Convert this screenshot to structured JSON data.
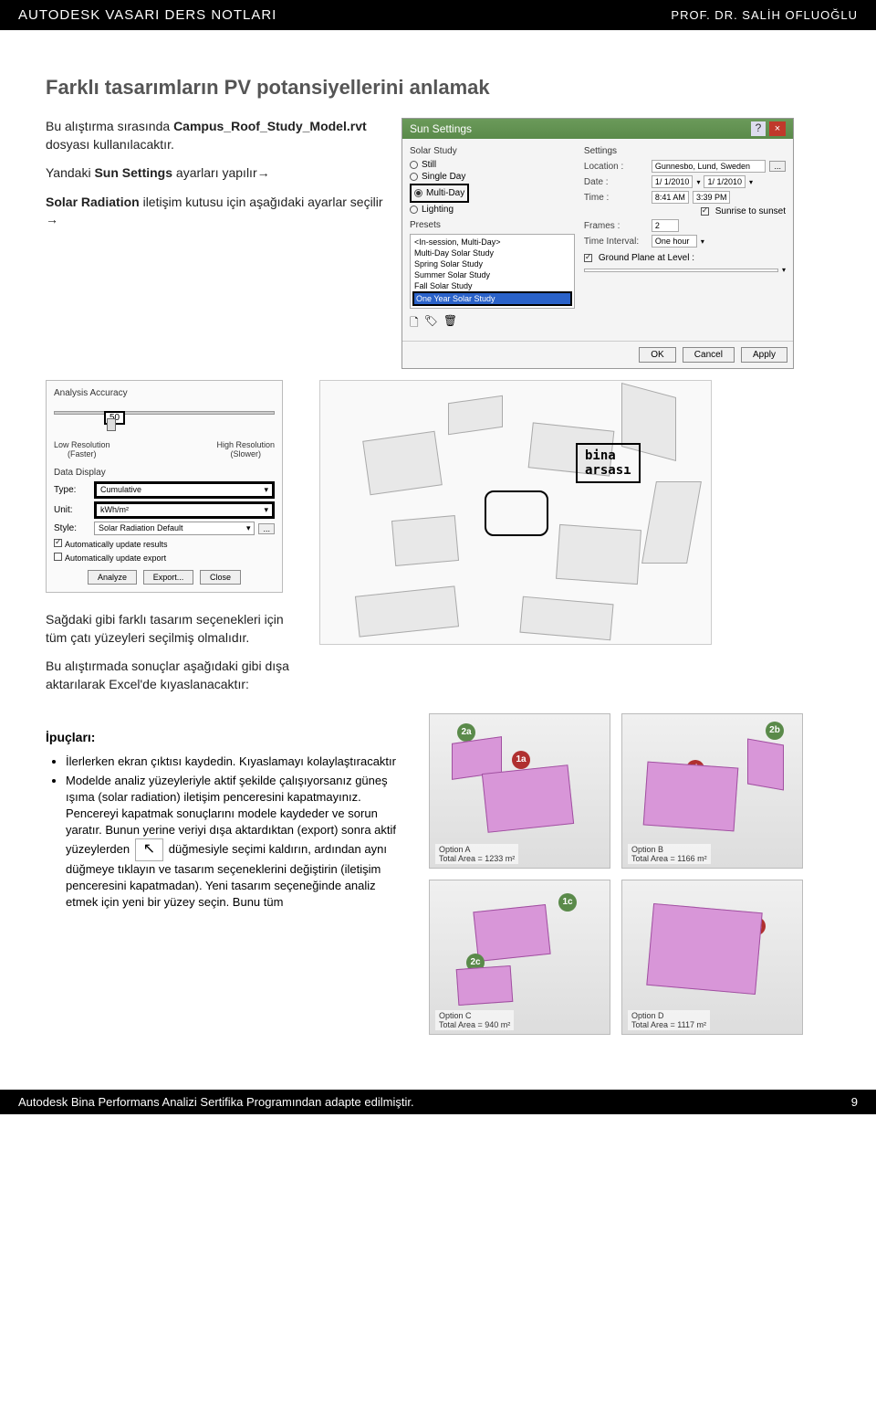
{
  "header": {
    "left": "AUTODESK VASARI DERS NOTLARI",
    "right": "PROF. DR. SALİH OFLUOĞLU"
  },
  "title": "Farklı tasarımların PV potansiyellerini anlamak",
  "intro": {
    "p1a": "Bu alıştırma sırasında ",
    "p1b": "Campus_Roof_Study_Model.rvt",
    "p1c": " dosyası kullanılacaktır.",
    "p2a": "Yandaki ",
    "p2b": "Sun Settings",
    "p2c": " ayarları yapılır→",
    "p3a": "Solar Radiation",
    "p3b": " iletişim kutusu için aşağıdaki ayarlar seçilir →"
  },
  "sun_dialog": {
    "title": "Sun Settings",
    "help": "?",
    "close": "×",
    "solar_study": "Solar Study",
    "settings": "Settings",
    "still": "Still",
    "single_day": "Single Day",
    "multi_day": "Multi-Day",
    "lighting": "Lighting",
    "location": "Location :",
    "location_val": "Gunnesbo, Lund, Sweden",
    "date": "Date :",
    "date_val1": "1/ 1/2010",
    "date_val2": "1/ 1/2010",
    "time": "Time :",
    "time_val1": "8:41 AM",
    "time_val2": "3:39 PM",
    "sunrise": "Sunrise to sunset",
    "frames": "Frames :",
    "frames_val": "2",
    "interval": "Time Interval:",
    "interval_val": "One hour",
    "ground": "Ground Plane at Level :",
    "presets": "Presets",
    "preset_items": [
      "<In-session, Multi-Day>",
      "Multi-Day Solar Study",
      "Spring Solar Study",
      "Summer Solar Study",
      "Fall Solar Study",
      "One Year Solar Study"
    ],
    "ok": "OK",
    "cancel": "Cancel",
    "apply": "Apply"
  },
  "analysis": {
    "title": "Analysis Accuracy",
    "val": "50",
    "low": "Low  Resolution\n(Faster)",
    "high": "High Resolution\n(Slower)",
    "data_display": "Data Display",
    "type": "Type:",
    "type_val": "Cumulative",
    "unit": "Unit:",
    "unit_val": "kWh/m²",
    "style": "Style:",
    "style_val": "Solar Radiation Default",
    "auto1": "Automatically update results",
    "auto2": "Automatically update export",
    "analyze": "Analyze",
    "export": "Export...",
    "close": "Close"
  },
  "map_label": "bina\narsası",
  "mid_text": {
    "p1": "Sağdaki gibi farklı tasarım seçenekleri için tüm çatı yüzeyleri seçilmiş olmalıdır.",
    "p2": "Bu alıştırmada sonuçlar aşağıdaki gibi dışa aktarılarak Excel'de kıyaslanacaktır:"
  },
  "tips_title": "İpuçları:",
  "tips": [
    "İlerlerken ekran çıktısı kaydedin. Kıyaslamayı kolaylaştıracaktır",
    "Modelde analiz yüzeyleriyle aktif şekilde çalışıyorsanız güneş ışıma (solar radiation) iletişim penceresini kapatmayınız. Pencereyi kapatmak sonuçlarını modele kaydeder ve sorun yaratır. Bunun yerine veriyi dışa aktardıktan (export) sonra aktif yüzeylerden",
    "düğmesiyle seçimi kaldırın, ardından aynı düğmeye tıklayın ve tasarım seçeneklerini değiştirin (iletişim penceresini kapatmadan). Yeni tasarım seçeneğinde analiz etmek için yeni bir yüzey seçin. Bunu tüm"
  ],
  "options": {
    "a": {
      "caption": "Option A",
      "sub": "Total Area = 1233 m²",
      "badges": [
        "2a",
        "1a"
      ]
    },
    "b": {
      "caption": "Option B",
      "sub": "Total Area = 1166 m²",
      "badges": [
        "2b",
        "1b"
      ]
    },
    "c": {
      "caption": "Option C",
      "sub": "Total Area = 940 m²",
      "badges": [
        "2c",
        "1c"
      ]
    },
    "d": {
      "caption": "Option D",
      "sub": "Total Area = 1117 m²",
      "badges": [
        "1d"
      ]
    }
  },
  "footer": {
    "left": "Autodesk Bina Performans Analizi Sertifika Programından adapte edilmiştir.",
    "right": "9"
  }
}
